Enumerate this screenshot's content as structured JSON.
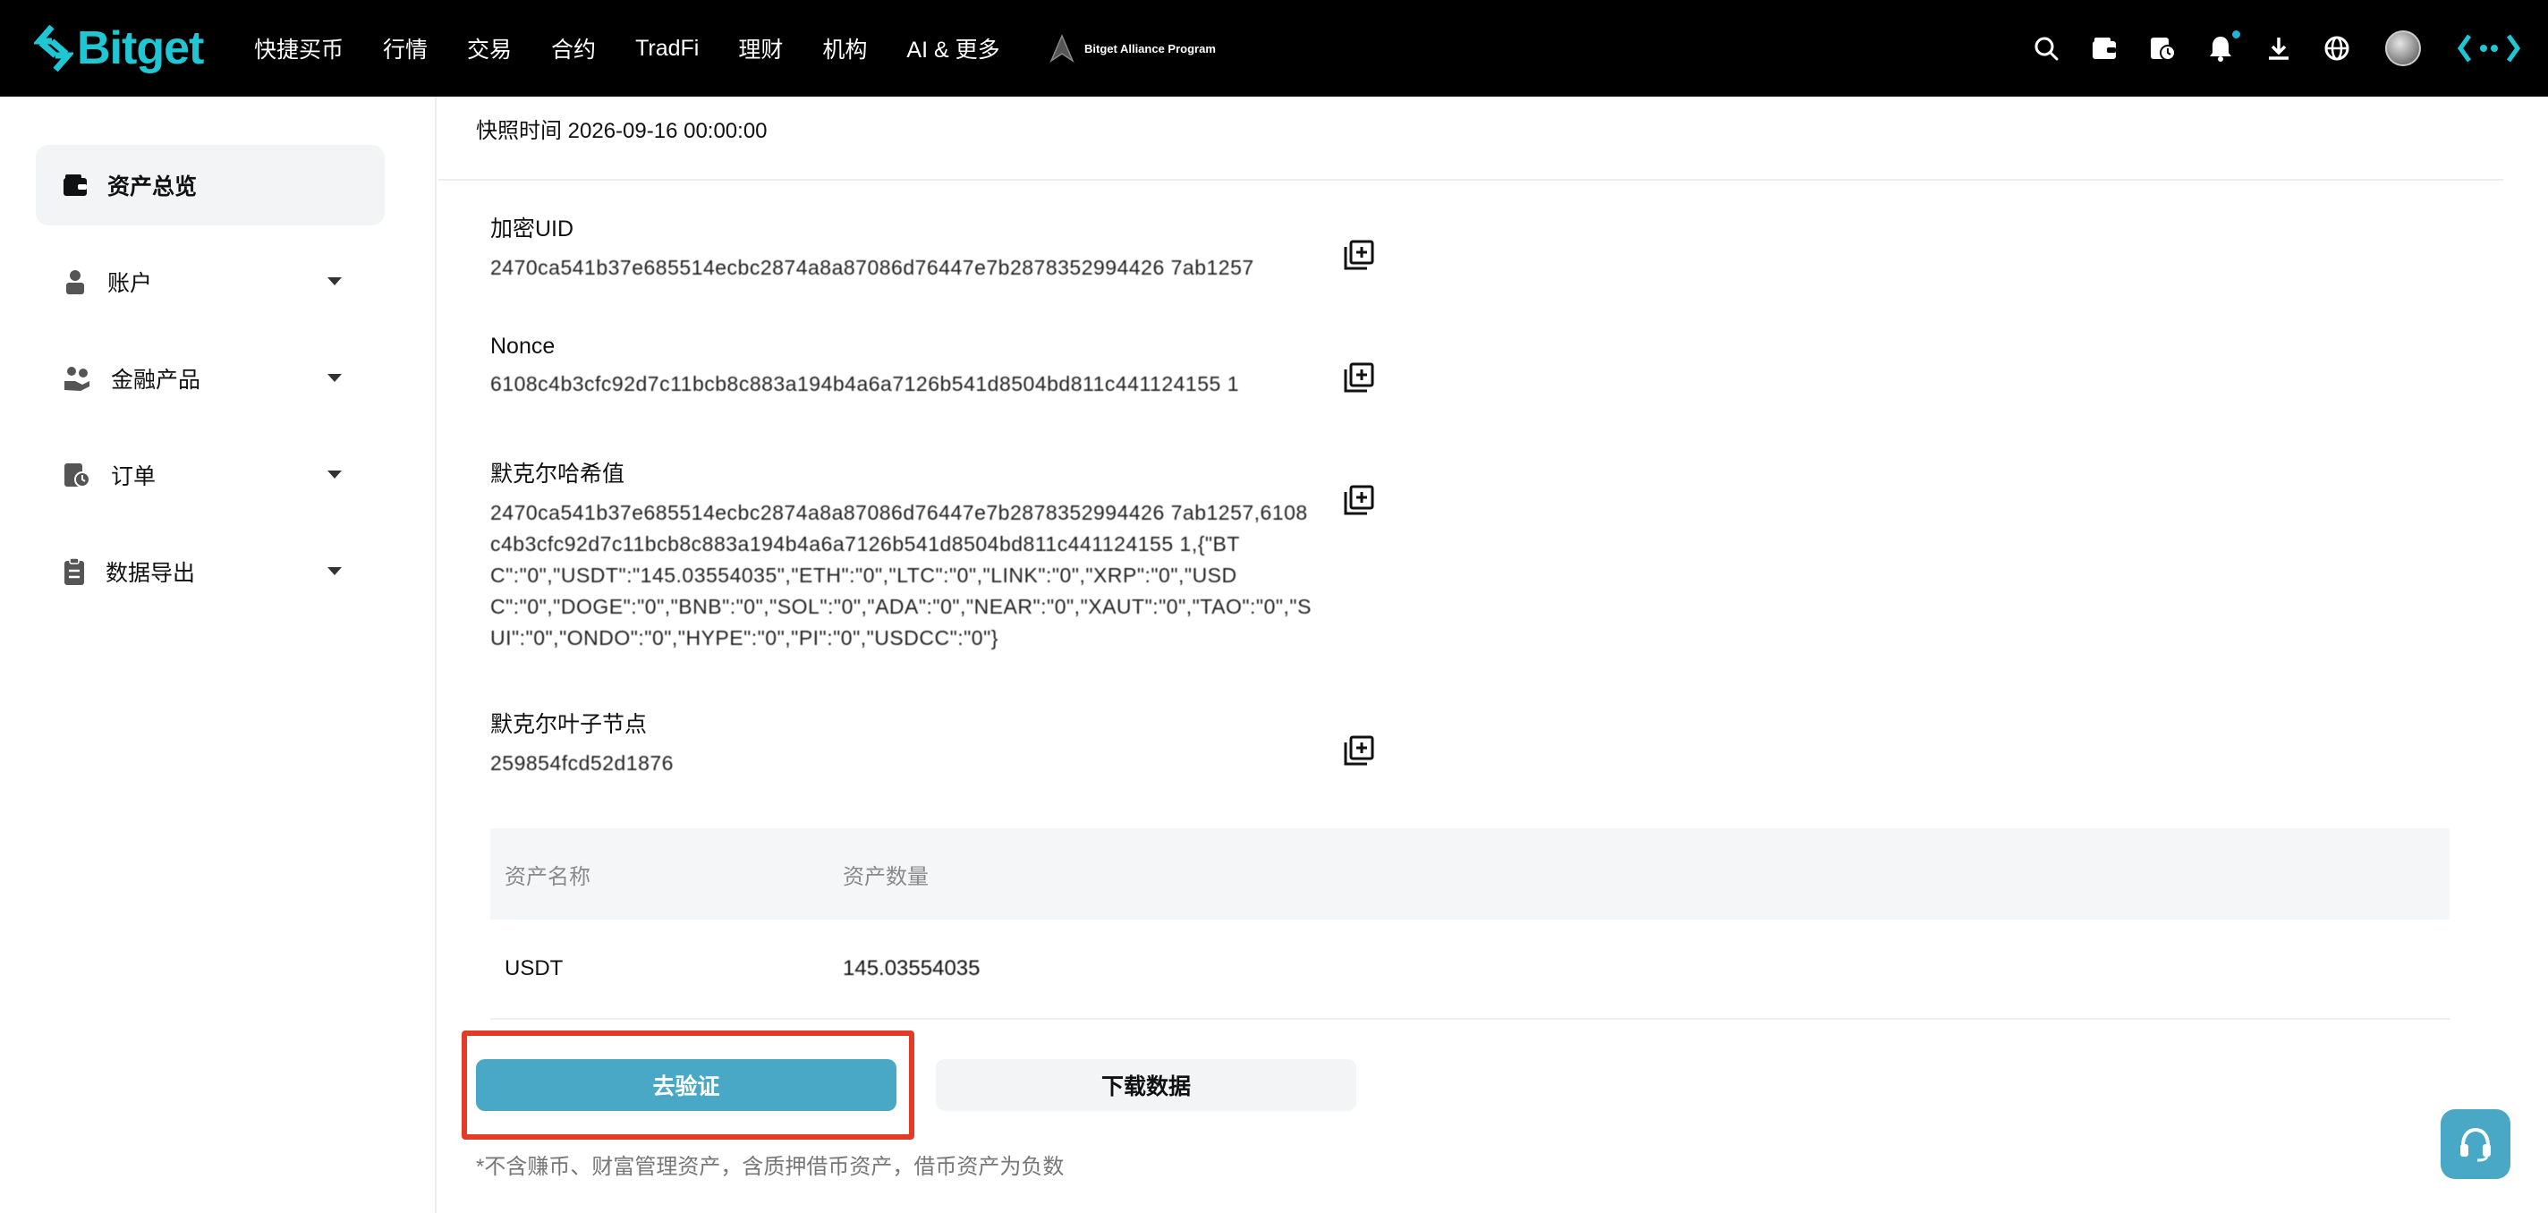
{
  "brand": {
    "name": "Bitget",
    "accent": "#1fc7d4"
  },
  "nav": {
    "items": [
      "快捷买币",
      "行情",
      "交易",
      "合约",
      "TradFi",
      "理财",
      "机构",
      "AI & 更多"
    ],
    "alliance_label": "Bitget Alliance Program",
    "icons": [
      "search-icon",
      "wallet-icon",
      "order-history-icon",
      "bell-icon",
      "download-icon",
      "globe-icon",
      "avatar",
      "brand-icon"
    ]
  },
  "sidebar": {
    "items": [
      {
        "label": "资产总览",
        "icon": "wallet-icon",
        "active": true
      },
      {
        "label": "账户",
        "icon": "account-icon",
        "active": false
      },
      {
        "label": "金融产品",
        "icon": "finance-icon",
        "active": false
      },
      {
        "label": "订单",
        "icon": "order-icon",
        "active": false
      },
      {
        "label": "数据导出",
        "icon": "clipboard-icon",
        "active": false
      }
    ]
  },
  "main": {
    "snapshot": "快照时间 2026-09-16 00:00:00",
    "fields": [
      {
        "label": "加密UID",
        "value": "2470ca541b37e685514ecbc2874a8a87086d76447e7b2878352994426 7ab1257"
      },
      {
        "label": "Nonce",
        "value": "6108c4b3cfc92d7c11bcb8c883a194b4a6a7126b541d8504bd811c441124155 1"
      },
      {
        "label": "默克尔哈希值",
        "value": "2470ca541b37e685514ecbc2874a8a87086d76447e7b2878352994426 7ab1257,6108c4b3cfc92d7c11bcb8c883a194b4a6a7126b541d8504bd811c441124155 1,{\"BTC\":\"0\",\"USDT\":\"145.03554035\",\"ETH\":\"0\",\"LTC\":\"0\",\"LINK\":\"0\",\"XRP\":\"0\",\"USDC\":\"0\",\"DOGE\":\"0\",\"BNB\":\"0\",\"SOL\":\"0\",\"ADA\":\"0\",\"NEAR\":\"0\",\"XAUT\":\"0\",\"TAO\":\"0\",\"SUI\":\"0\",\"ONDO\":\"0\",\"HYPE\":\"0\",\"PI\":\"0\",\"USDCC\":\"0\"}"
      },
      {
        "label": "默克尔叶子节点",
        "value": "259854fcd52d1876"
      }
    ],
    "table": {
      "headers": [
        "资产名称",
        "资产数量"
      ],
      "rows": [
        {
          "asset": "USDT",
          "amount": "145.03554035"
        }
      ]
    },
    "verify_button": "去验证",
    "download_button": "下载数据",
    "footnote": "*不含赚币、财富管理资产，含质押借币资产，借币资产为负数"
  },
  "colors": {
    "primary_button": "#49a8c6",
    "highlight": "#e23b26",
    "nav_bg": "#000000"
  }
}
